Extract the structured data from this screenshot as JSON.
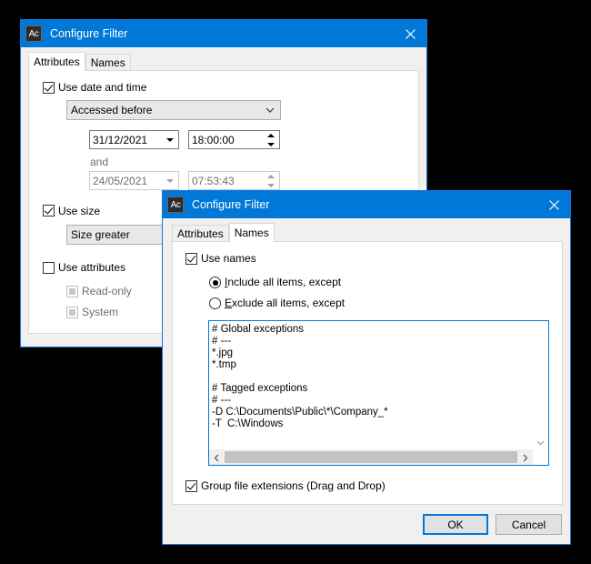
{
  "back_window": {
    "title": "Configure Filter",
    "app_icon": "Ac",
    "tabs": [
      {
        "label": "Attributes",
        "active": true
      },
      {
        "label": "Names",
        "active": false
      }
    ],
    "use_date_time": {
      "label": "Use date and time",
      "checked": true
    },
    "date_mode": "Accessed before",
    "date1": "31/12/2021",
    "time1": "18:00:00",
    "and_label": "and",
    "date2": "24/05/2021",
    "time2": "07:53:43",
    "use_size": {
      "label": "Use size",
      "checked": true
    },
    "size_mode": "Size greater",
    "use_attributes": {
      "label": "Use attributes",
      "checked": false
    },
    "readonly_label": "Read-only",
    "system_label": "System"
  },
  "front_window": {
    "title": "Configure Filter",
    "app_icon": "Ac",
    "tabs": [
      {
        "label": "Attributes",
        "active": false
      },
      {
        "label": "Names",
        "active": true
      }
    ],
    "use_names": {
      "label": "Use names",
      "checked": true
    },
    "include_radio": {
      "prefix": "I",
      "rest": "nclude all items, except",
      "selected": true
    },
    "exclude_radio": {
      "prefix": "E",
      "rest": "xclude all items, except",
      "selected": false
    },
    "exceptions_lines": [
      "# Global exceptions",
      "# ---",
      "*.jpg",
      "*.tmp",
      "",
      "# Tagged exceptions",
      "# ---",
      "-D C:\\Documents\\Public\\*\\Company_*",
      "-T  C:\\Windows"
    ],
    "group_ext": {
      "label": "Group file extensions (Drag and Drop)",
      "checked": true
    },
    "ok_label": "OK",
    "cancel_label": "Cancel"
  },
  "colors": {
    "titlebar": "#0078d7",
    "window_bg": "#f0f0f0"
  }
}
